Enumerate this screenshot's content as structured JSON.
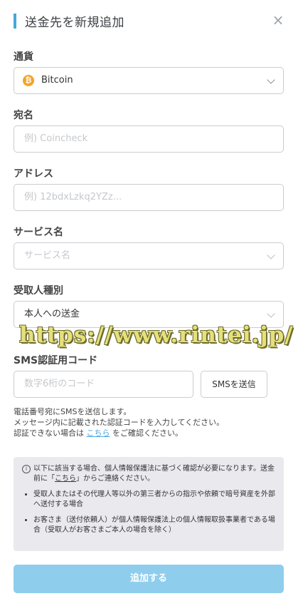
{
  "header": {
    "title": "送金先を新規追加",
    "close_symbol": "×"
  },
  "currency": {
    "label": "通貨",
    "value": "Bitcoin",
    "icon_symbol": "₿",
    "icon_color": "#f7a325"
  },
  "name_field": {
    "label": "宛名",
    "placeholder": "例) Coincheck"
  },
  "address_field": {
    "label": "アドレス",
    "placeholder": "例) 12bdxLzkq2YZz..."
  },
  "service_field": {
    "label": "サービス名",
    "placeholder": "サービス名"
  },
  "recipient_type": {
    "label": "受取人種別",
    "value": "本人への送金"
  },
  "sms": {
    "label": "SMS認証用コード",
    "placeholder": "数字6桁のコード",
    "send_button": "SMSを送信",
    "help_line1": "電話番号宛にSMSを送信します。",
    "help_line2": "メッセージ内に記載された認証コードを入力してください。",
    "help_line3_prefix": "認証できない場合は ",
    "help_link": "こちら",
    "help_line3_suffix": " をご確認ください。"
  },
  "notice": {
    "head_text": "以下に該当する場合、個人情報保護法に基づく確認が必要になります。送金前に「",
    "head_link": "こちら",
    "head_suffix": "」からご連絡ください。",
    "items": [
      "受取人またはその代理人等以外の第三者からの指示や依頼で暗号資産を外部へ送付する場合",
      "お客さま（送付依頼人）が個人情報保護法上の個人情報取扱事業者である場合（受取人がお客さまご本人の場合を除く）"
    ]
  },
  "submit": {
    "label": "追加する"
  },
  "watermark": {
    "text": "https://www.rintei.jp/"
  },
  "colors": {
    "accent": "#45a7dc",
    "submit_disabled": "#8fcded",
    "notice_bg": "#e9e9ee"
  }
}
